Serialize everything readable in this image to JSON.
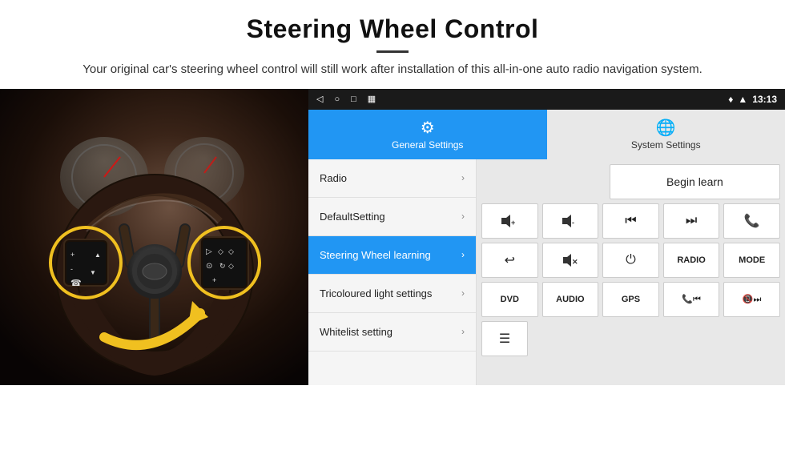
{
  "header": {
    "title": "Steering Wheel Control",
    "subtitle": "Your original car's steering wheel control will still work after installation of this all-in-one auto radio navigation system."
  },
  "statusBar": {
    "time": "13:13",
    "icons": [
      "◁",
      "○",
      "□",
      "▦"
    ]
  },
  "tabs": [
    {
      "id": "general",
      "label": "General Settings",
      "active": true
    },
    {
      "id": "system",
      "label": "System Settings",
      "active": false
    }
  ],
  "menu": {
    "items": [
      {
        "label": "Radio",
        "active": false
      },
      {
        "label": "DefaultSetting",
        "active": false
      },
      {
        "label": "Steering Wheel learning",
        "active": true
      },
      {
        "label": "Tricoloured light settings",
        "active": false
      },
      {
        "label": "Whitelist setting",
        "active": false
      }
    ]
  },
  "rightPanel": {
    "beginLearnLabel": "Begin learn",
    "buttons": {
      "row1": [
        "🔊+",
        "🔊-",
        "⏮",
        "⏭",
        "📞"
      ],
      "row2": [
        "↩",
        "🔇",
        "⏻",
        "RADIO",
        "MODE"
      ],
      "row3": [
        "DVD",
        "AUDIO",
        "GPS",
        "📞⏮",
        "📵⏭"
      ]
    },
    "bottomIcon": "☰"
  }
}
